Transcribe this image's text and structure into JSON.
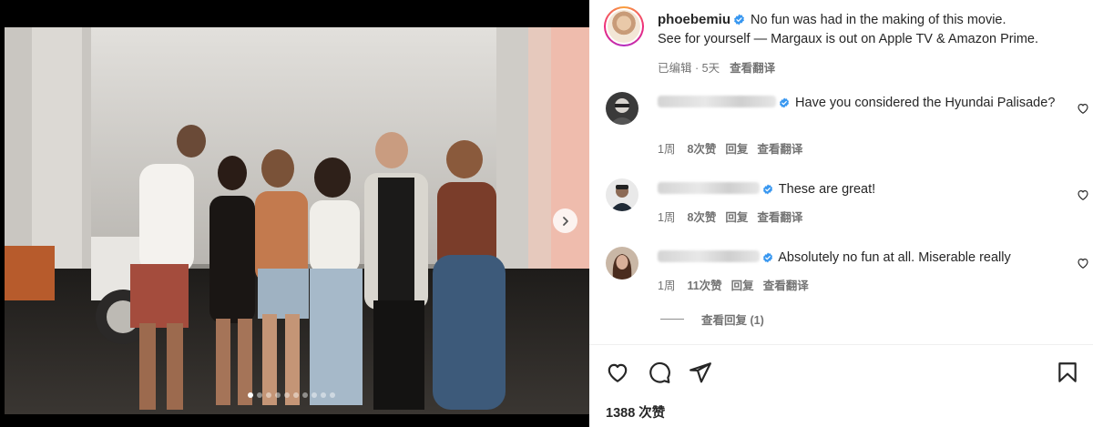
{
  "post": {
    "username": "phoebemiu",
    "caption_line1": "No fun was had in the making of this movie.",
    "caption_line2": "See for yourself — Margaux is out on Apple TV & Amazon Prime.",
    "edited_label": "已编辑",
    "time": "5天",
    "translate_label": "查看翻译",
    "likes_text": "1388 次赞"
  },
  "comments": [
    {
      "text": "Have you considered the Hyundai Palisade?",
      "time": "1周",
      "likes": "8次赞",
      "reply": "回复",
      "translate": "查看翻译",
      "avatar_icon": "user-avatar-icon"
    },
    {
      "text": "These are great!",
      "time": "1周",
      "likes": "8次赞",
      "reply": "回复",
      "translate": "查看翻译",
      "avatar_icon": "user-avatar-icon"
    },
    {
      "text": "Absolutely no fun at all. Miserable really",
      "time": "1周",
      "likes": "11次赞",
      "reply": "回复",
      "translate": "查看翻译",
      "avatar_icon": "user-avatar-icon"
    }
  ],
  "view_replies_label": "查看回复 (1)",
  "carousel": {
    "slide_count": 10,
    "active_index": 0
  },
  "colors": {
    "verified": "#3897f0",
    "text": "#262626",
    "muted": "#737373",
    "divider": "#efefef"
  },
  "icons": [
    "heart-icon",
    "comment-icon",
    "share-icon",
    "bookmark-icon",
    "chevron-right-icon",
    "verified-badge-icon"
  ]
}
